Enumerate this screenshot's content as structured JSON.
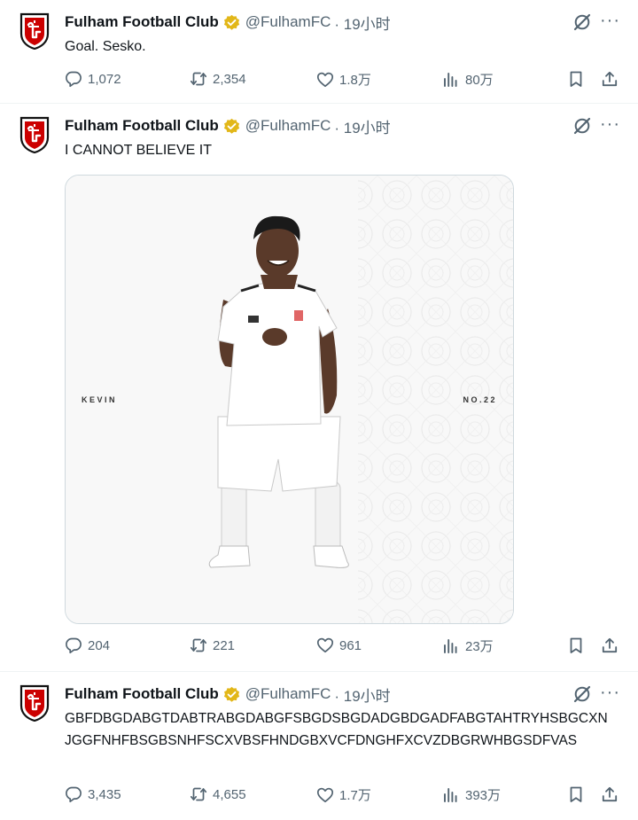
{
  "tweets": [
    {
      "author": "Fulham Football Club",
      "handle": "@FulhamFC",
      "time": "· 19小时",
      "text": "Goal. Sesko.",
      "replies": "1,072",
      "reposts": "2,354",
      "likes": "1.8万",
      "views": "80万"
    },
    {
      "author": "Fulham Football Club",
      "handle": "@FulhamFC",
      "time": "· 19小时",
      "text": "I CANNOT BELIEVE IT",
      "media": {
        "left_label": "KEVIN",
        "right_label": "NO.22"
      },
      "replies": "204",
      "reposts": "221",
      "likes": "961",
      "views": "23万"
    },
    {
      "author": "Fulham Football Club",
      "handle": "@FulhamFC",
      "time": "· 19小时",
      "text": "GBFDBGDABGTDABTRABGDABGFSBGDSBGDADGBDGADFABGTAHTRYHSBGCXNJGGFNHFBSGBSNHFSCXVBSFHNDGBXVCFDNGHFXCVZDBGRWHBGSDFVAS",
      "replies": "3,435",
      "reposts": "4,655",
      "likes": "1.7万",
      "views": "393万"
    }
  ],
  "icons": {
    "verified": "verified-badge-gold",
    "grok": "grok-icon",
    "more": "more-icon",
    "reply": "reply-icon",
    "repost": "repost-icon",
    "like": "like-icon",
    "views": "views-icon",
    "bookmark": "bookmark-icon",
    "share": "share-icon"
  },
  "colors": {
    "text": "#0f1419",
    "secondary": "#536471",
    "verified": "#e2b719",
    "brand": "#cc0000"
  }
}
